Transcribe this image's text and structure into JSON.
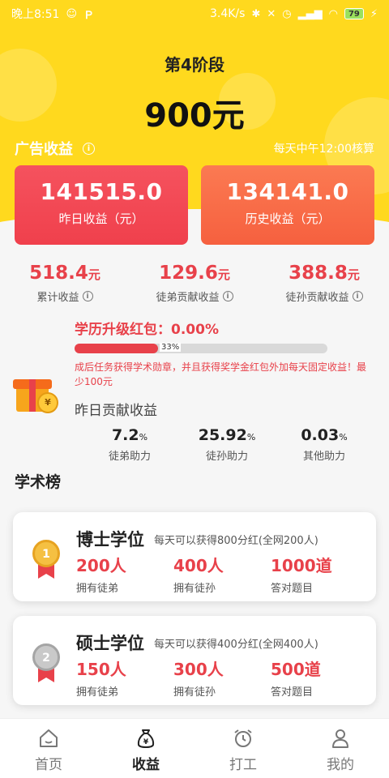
{
  "status_bar": {
    "time": "晚上8:51",
    "speed": "3.4K/s",
    "battery": "79"
  },
  "header": {
    "stage": "第4阶段",
    "amount": "900元"
  },
  "ad_income": {
    "title": "广告收益",
    "note": "每天中午12:00核算"
  },
  "cards": [
    {
      "value": "141515.0",
      "label": "昨日收益（元）"
    },
    {
      "value": "134141.0",
      "label": "历史收益（元）"
    }
  ],
  "stats": [
    {
      "value": "518.4",
      "unit": "元",
      "label": "累计收益"
    },
    {
      "value": "129.6",
      "unit": "元",
      "label": "徒弟贡献收益"
    },
    {
      "value": "388.8",
      "unit": "元",
      "label": "徒孙贡献收益"
    }
  ],
  "education": {
    "title": "学历升级红包：0.00%",
    "progress_percent": 33,
    "progress_label": "33%",
    "description": "成后任务获得学术勋章，并且获得奖学金红包外加每天固定收益！最少100元"
  },
  "contribution": {
    "title": "昨日贡献收益",
    "items": [
      {
        "value": "7.2",
        "unit": "%",
        "label": "徒弟助力"
      },
      {
        "value": "25.92",
        "unit": "%",
        "label": "徒孙助力"
      },
      {
        "value": "0.03",
        "unit": "%",
        "label": "其他助力"
      }
    ]
  },
  "ranking": {
    "title": "学术榜",
    "cards": [
      {
        "medal": "1",
        "degree": "博士学位",
        "note": "每天可以获得800分红(全网200人)",
        "stats": [
          {
            "value": "200人",
            "label": "拥有徒弟"
          },
          {
            "value": "400人",
            "label": "拥有徒孙"
          },
          {
            "value": "1000道",
            "label": "答对题目"
          }
        ]
      },
      {
        "medal": "2",
        "degree": "硕士学位",
        "note": "每天可以获得400分红(全网400人)",
        "stats": [
          {
            "value": "150人",
            "label": "拥有徒弟"
          },
          {
            "value": "300人",
            "label": "拥有徒孙"
          },
          {
            "value": "500道",
            "label": "答对题目"
          }
        ]
      }
    ]
  },
  "tabs": [
    {
      "label": "首页",
      "icon": "home-icon"
    },
    {
      "label": "收益",
      "icon": "money-bag-icon"
    },
    {
      "label": "打工",
      "icon": "alarm-clock-icon"
    },
    {
      "label": "我的",
      "icon": "user-icon"
    }
  ],
  "colors": {
    "brand_yellow": "#ffd91e",
    "accent_red": "#e8414a",
    "card_red": "#f0404c",
    "card_orange": "#f6603f"
  }
}
